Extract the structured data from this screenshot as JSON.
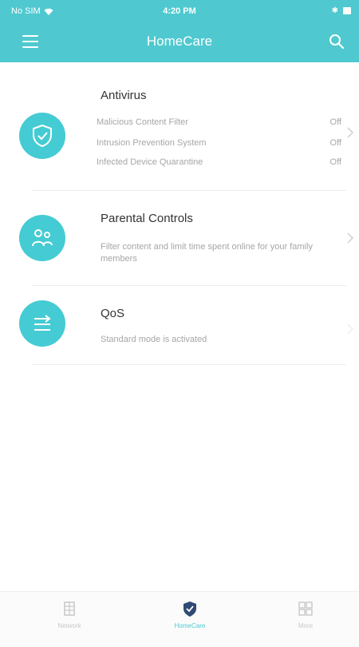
{
  "status_bar": {
    "carrier": "No SIM",
    "time": "4:20 PM"
  },
  "header": {
    "title": "HomeCare"
  },
  "cards": [
    {
      "title": "Antivirus",
      "rows": [
        {
          "label": "Malicious Content Filter",
          "value": "Off"
        },
        {
          "label": "Intrusion Prevention System",
          "value": "Off"
        },
        {
          "label": "Infected Device Quarantine",
          "value": "Off"
        }
      ]
    },
    {
      "title": "Parental Controls",
      "description": "Filter content and limit time spent online for your family members"
    },
    {
      "title": "QoS",
      "description": "Standard mode is activated"
    }
  ],
  "bottom_nav": {
    "tabs": [
      {
        "label": "Network"
      },
      {
        "label": "HomeCare"
      },
      {
        "label": "More"
      }
    ]
  },
  "colors": {
    "header": "#4fc9cf",
    "icon_circle": "#45cbd3",
    "accent": "#4fc9cf"
  }
}
